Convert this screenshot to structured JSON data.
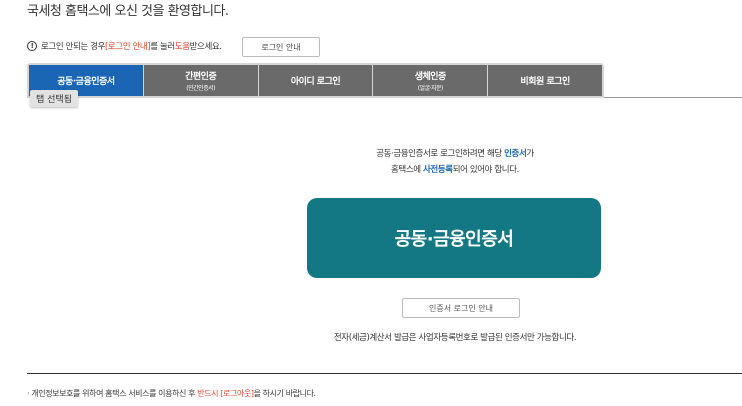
{
  "welcome": "국세청 홈택스에 오신 것을 환영합니다.",
  "notice": {
    "part1": "로그인 안되는 경우 ",
    "link1": "[로그인 안내]",
    "part2": "를 눌러 ",
    "link2": "도움",
    "part3": "받으세요.",
    "button": "로그인 안내"
  },
  "tabs": [
    {
      "label": "공동·금융인증서",
      "sub": ""
    },
    {
      "label": "간편인증",
      "sub": "(민간인증서)"
    },
    {
      "label": "아이디 로그인",
      "sub": ""
    },
    {
      "label": "생체인증",
      "sub": "(얼굴·지문)"
    },
    {
      "label": "비회원 로그인",
      "sub": ""
    }
  ],
  "tab_selected_label": "탭 선택됨",
  "description": {
    "line1a": "공동·금융인증서로 로그인하려면 해당 ",
    "line1b": "인증서",
    "line1c": "가",
    "line2a": "홈택스에 ",
    "line2b": "사전등록",
    "line2c": "되어 있어야 합니다."
  },
  "cert_button": "공동·금융인증서",
  "cert_guide_button": "인증서 로그인 안내",
  "tax_note": "전자(세금)계산서 발급은 사업자등록번호로 발급된 인증서만 가능합니다.",
  "footer": {
    "part1": "· 개인정보보호를 위하여 홈택스 서비스를 이용하신 후 ",
    "highlight": "반드시 [로그아웃]",
    "part2": "을 하시기 바랍니다."
  },
  "colors": {
    "active_tab": "#1a66b4",
    "inactive_tab": "#6a6a6a",
    "cert_button": "#137883",
    "highlight": "#e8452c"
  }
}
